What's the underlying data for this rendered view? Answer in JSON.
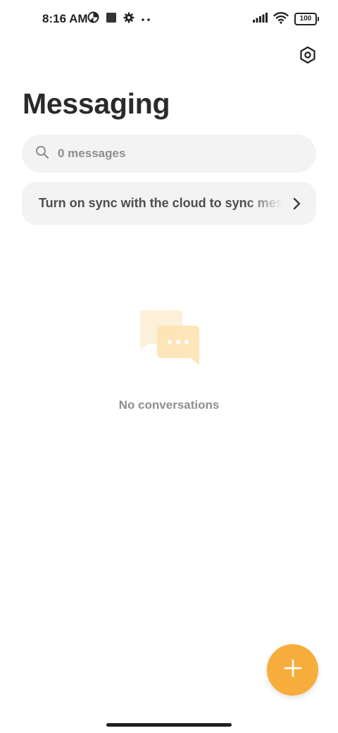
{
  "status_bar": {
    "time": "8:16 AM",
    "battery_level": "100",
    "left_icons": [
      "data-saver-icon",
      "stop-square-icon",
      "gear-small-icon",
      "more-dots-icon"
    ],
    "right_icons": [
      "signal-icon",
      "wifi-icon",
      "battery-icon"
    ]
  },
  "header": {
    "settings_icon": "settings-hexagon-icon",
    "title": "Messaging"
  },
  "search": {
    "placeholder": "0 messages",
    "icon": "search-icon"
  },
  "sync_banner": {
    "text": "Turn on sync with the cloud to sync messages",
    "icon": "chevron-right-icon"
  },
  "empty_state": {
    "icon": "chat-bubbles-icon",
    "text": "No conversations"
  },
  "fab": {
    "icon": "plus-icon"
  },
  "colors": {
    "accent": "#f7ad3b",
    "surface": "#f3f3f3",
    "title": "#2a2a2a",
    "muted": "#8f8f8f"
  }
}
